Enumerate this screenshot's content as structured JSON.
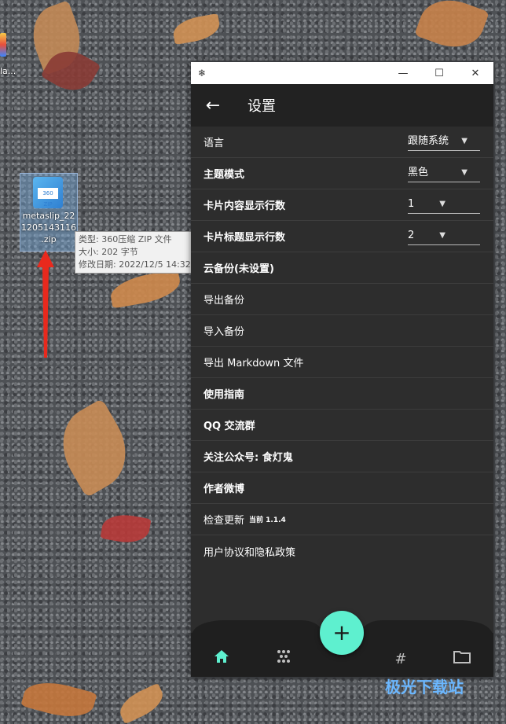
{
  "desktop": {
    "partial_icon_label": "la...",
    "zip_file": {
      "name": "metaslip_221205143116.zip",
      "name_lines": [
        "metaslip_22",
        "1205143116",
        ".zip"
      ],
      "badge": "360 ZIP"
    },
    "tooltip": {
      "lines": [
        "类型: 360压缩 ZIP 文件",
        "大小: 202 字节",
        "修改日期: 2022/12/5 14:32"
      ]
    }
  },
  "window": {
    "titlebar": {
      "app_icon": "snowflake-icon",
      "minimize": "—",
      "maximize": "☐",
      "close": "✕"
    },
    "header": {
      "back": "←",
      "title": "设置"
    },
    "settings": [
      {
        "label": "语言",
        "value": "跟随系统"
      },
      {
        "label": "主题模式",
        "value": "黑色"
      },
      {
        "label": "卡片内容显示行数",
        "value": "1"
      },
      {
        "label": "卡片标题显示行数",
        "value": "2"
      },
      {
        "label": "云备份(未设置)"
      },
      {
        "label": "导出备份"
      },
      {
        "label": "导入备份"
      },
      {
        "label": "导出 Markdown 文件"
      },
      {
        "label": "使用指南"
      },
      {
        "label": "QQ 交流群"
      },
      {
        "label": "关注公众号: 食灯鬼"
      },
      {
        "label": "作者微博"
      },
      {
        "label": "检查更新",
        "extra": "当前 1.1.4"
      },
      {
        "label": "用户协议和隐私政策"
      }
    ],
    "fab": "+",
    "nav": {
      "home": "home-icon",
      "grid": "dots-icon",
      "tags": "#",
      "folder": "folder-icon"
    }
  },
  "colors": {
    "accent": "#5ef0cf",
    "panel": "#2d2d2d",
    "arrow": "#e8291d"
  },
  "watermark": "极光下载站"
}
